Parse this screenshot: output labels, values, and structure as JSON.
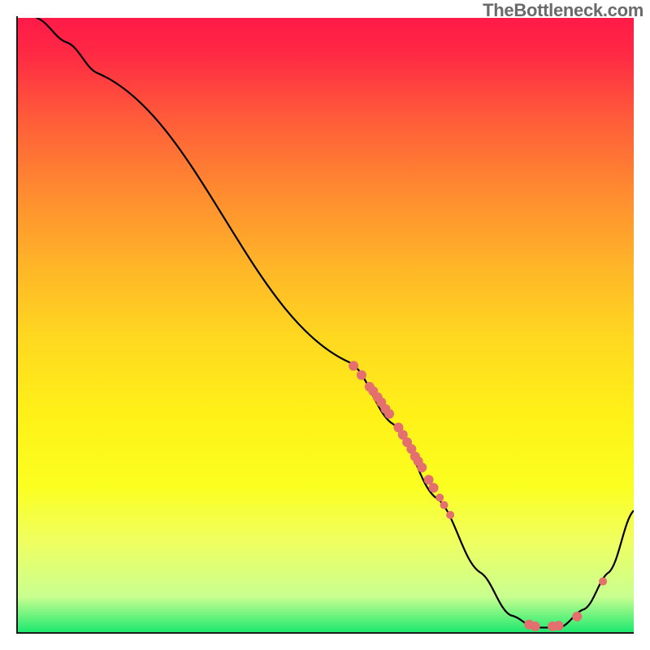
{
  "attribution": "TheBottleneck.com",
  "chart_data": {
    "type": "line",
    "title": "",
    "xlabel": "",
    "ylabel": "",
    "xlim": [
      0,
      100
    ],
    "ylim": [
      0,
      100
    ],
    "curve_points": [
      {
        "x": 3,
        "y": 100
      },
      {
        "x": 8,
        "y": 96
      },
      {
        "x": 13,
        "y": 91
      },
      {
        "x": 54,
        "y": 44
      },
      {
        "x": 61,
        "y": 34
      },
      {
        "x": 68,
        "y": 22
      },
      {
        "x": 75,
        "y": 10
      },
      {
        "x": 80,
        "y": 3
      },
      {
        "x": 84,
        "y": 1
      },
      {
        "x": 88,
        "y": 1
      },
      {
        "x": 92,
        "y": 4
      },
      {
        "x": 96,
        "y": 10
      },
      {
        "x": 100,
        "y": 20
      }
    ],
    "markers": [
      {
        "x": 54.5,
        "y": 43.5,
        "r": 6
      },
      {
        "x": 55.8,
        "y": 42.0,
        "r": 6
      },
      {
        "x": 57.1,
        "y": 40.1,
        "r": 6
      },
      {
        "x": 57.7,
        "y": 39.4,
        "r": 6
      },
      {
        "x": 58.4,
        "y": 38.4,
        "r": 6
      },
      {
        "x": 59.0,
        "y": 37.6,
        "r": 6
      },
      {
        "x": 59.7,
        "y": 36.5,
        "r": 6
      },
      {
        "x": 60.3,
        "y": 35.7,
        "r": 6
      },
      {
        "x": 61.8,
        "y": 33.5,
        "r": 6
      },
      {
        "x": 62.5,
        "y": 32.3,
        "r": 6
      },
      {
        "x": 63.2,
        "y": 31.1,
        "r": 6
      },
      {
        "x": 63.9,
        "y": 30.0,
        "r": 6
      },
      {
        "x": 64.5,
        "y": 28.8,
        "r": 6
      },
      {
        "x": 65.0,
        "y": 28.0,
        "r": 6
      },
      {
        "x": 65.6,
        "y": 27.0,
        "r": 6
      },
      {
        "x": 66.7,
        "y": 25.0,
        "r": 6
      },
      {
        "x": 67.5,
        "y": 23.7,
        "r": 6
      },
      {
        "x": 68.5,
        "y": 22.1,
        "r": 5
      },
      {
        "x": 69.2,
        "y": 20.9,
        "r": 5
      },
      {
        "x": 70.2,
        "y": 19.3,
        "r": 5
      },
      {
        "x": 83.0,
        "y": 1.5,
        "r": 6
      },
      {
        "x": 84.0,
        "y": 1.2,
        "r": 6
      },
      {
        "x": 86.8,
        "y": 1.2,
        "r": 6
      },
      {
        "x": 87.8,
        "y": 1.3,
        "r": 6
      },
      {
        "x": 90.8,
        "y": 2.8,
        "r": 6
      },
      {
        "x": 95.0,
        "y": 8.5,
        "r": 5
      }
    ],
    "marker_color": "#e46f6f",
    "curve_color": "#000000"
  }
}
